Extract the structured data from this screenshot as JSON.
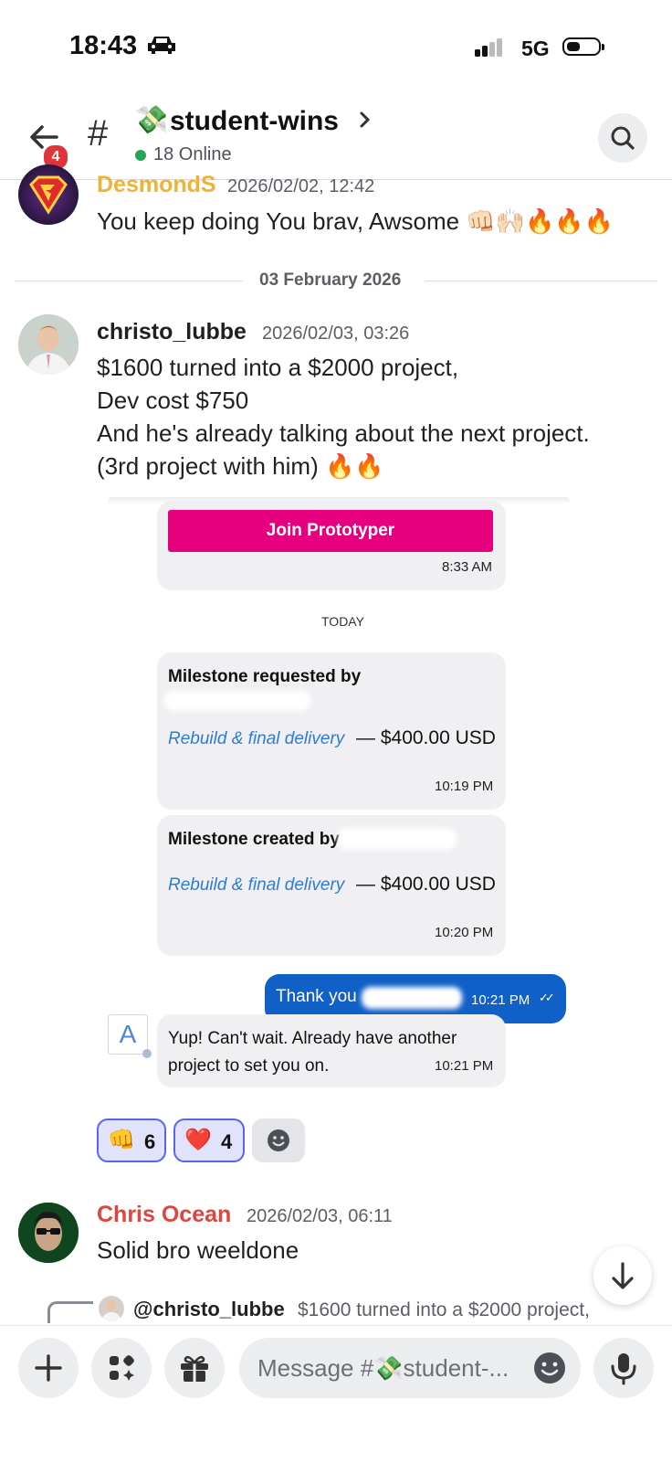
{
  "status_bar": {
    "time": "18:43",
    "network": "5G"
  },
  "header": {
    "back_badge": "4",
    "channel_emoji": "💸",
    "channel_name": "student-wins",
    "online": "18 Online"
  },
  "messages": [
    {
      "author": "DesmondS",
      "timestamp": "2026/02/02, 12:42",
      "text": "You keep doing You brav, Awsome 👊🏻🙌🏻🔥🔥🔥",
      "author_color": "#f0b232"
    },
    {
      "author": "christo_lubbe",
      "timestamp": "2026/02/03, 03:26",
      "lines": [
        "$1600 turned into a $2000 project,",
        "Dev cost $750",
        "And he's already talking about the next project.",
        "(3rd project with him) 🔥🔥"
      ],
      "author_color": "#1f2023"
    },
    {
      "author": "Chris Ocean",
      "timestamp": "2026/02/03, 06:11",
      "text": "Solid bro weeldone",
      "author_color": "#e0453c"
    }
  ],
  "date_divider": "03 February 2026",
  "embed": {
    "join_button": "Join Prototyper",
    "join_time": "8:33 AM",
    "today": "TODAY",
    "milestone1": {
      "title": "Milestone requested by",
      "link": "Rebuild & final delivery",
      "amount": "— $400.00 USD",
      "time": "10:19 PM"
    },
    "milestone2": {
      "title": "Milestone created by",
      "link": "Rebuild & final delivery",
      "amount": "— $400.00 USD",
      "time": "10:20 PM"
    },
    "outgoing": {
      "text": "Thank you",
      "time": "10:21 PM",
      "ticks": "✓✓"
    },
    "incoming": {
      "avatar_letter": "A",
      "line1": "Yup! Can't wait. Already have another",
      "line2": "project to set you on.",
      "time": "10:21 PM"
    },
    "colors": {
      "join": "#e6007e",
      "outgoing": "#1160c8"
    }
  },
  "reactions": [
    {
      "emoji": "👊",
      "count": "6"
    },
    {
      "emoji": "❤️",
      "count": "4"
    }
  ],
  "reply": {
    "mention": "@christo_lubbe",
    "preview": "$1600 turned into a $2000 project,"
  },
  "composer": {
    "placeholder": "Message #💸student-..."
  },
  "icons": {
    "back": "arrow-left-icon",
    "search": "search-icon",
    "plus": "plus-icon",
    "apps": "apps-icon",
    "gift": "gift-icon",
    "emoji": "emoji-icon",
    "mic": "mic-icon",
    "down": "arrow-down-icon"
  }
}
